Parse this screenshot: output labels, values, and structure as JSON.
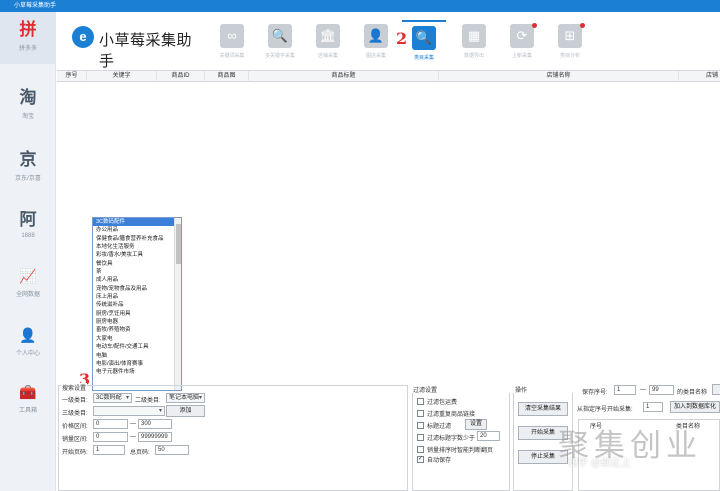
{
  "window": {
    "title": "小草莓采集助手"
  },
  "sidebar": {
    "items": [
      {
        "glyph": "拼",
        "label": "拼多多",
        "active": true
      },
      {
        "glyph": "淘",
        "label": "淘宝"
      },
      {
        "glyph": "京",
        "label": "京东/京喜"
      },
      {
        "glyph": "阿",
        "label": "1688"
      },
      {
        "glyph": "📈",
        "label": "全网数据"
      },
      {
        "glyph": "👤",
        "label": "个人中心"
      },
      {
        "glyph": "🧰",
        "label": "工具箱"
      }
    ]
  },
  "app": {
    "logo_mark": "e",
    "name": "小草莓采集助手"
  },
  "toolbar": {
    "items": [
      {
        "icon": "∞",
        "label": "关键词采集"
      },
      {
        "icon": "🔍",
        "label": "多关键字采集"
      },
      {
        "icon": "🏛",
        "label": "店铺采集"
      },
      {
        "icon": "👤",
        "label": "图店采集"
      },
      {
        "icon": "🔍",
        "label": "类目采集",
        "active": true
      },
      {
        "icon": "▦",
        "label": "数据导出"
      },
      {
        "icon": "⟳",
        "label": "上新采集"
      },
      {
        "icon": "⊞",
        "label": "类目分析"
      }
    ]
  },
  "grid": {
    "columns": [
      "序号",
      "关键字",
      "商品ID",
      "商品图",
      "商品标题",
      "店铺名称",
      "店铺"
    ]
  },
  "category_dropdown": {
    "options": [
      "3C数码配件",
      "办公用品",
      "保健食品/膳食营养补充食品",
      "本地化生活服务",
      "彩妆/香水/美妆工具",
      "餐饮具",
      "茶",
      "成人用品",
      "宠物/宠物食品及用品",
      "床上用品",
      "传统滋补品",
      "厨房/烹饪用具",
      "厨房电器",
      "畜牧/养殖物资",
      "大家电",
      "电动车/配件/交通工具",
      "电脑",
      "电影/演出/体育赛事",
      "电子元器件市场"
    ],
    "selected": "3C数码配件"
  },
  "search_settings": {
    "title": "搜索设置",
    "level1_label": "一级类目:",
    "level1_value": "3C数码配",
    "level2_label": "二级类目:",
    "level2_value": "笔记本电脑",
    "level3_label": "三级类目:",
    "level3_value": "",
    "add_button": "添加",
    "price_label": "价格区间:",
    "price_min": "0",
    "price_max": "300",
    "dash": "—",
    "sales_label": "销量区间:",
    "sales_min": "0",
    "sales_max": "99999999",
    "start_page_label": "开始页码:",
    "start_page": "1",
    "total_pages_label": "总页码:",
    "total_pages": "50"
  },
  "filter_settings": {
    "title": "过滤设置",
    "options": [
      {
        "label": "过滤包运费",
        "checked": false
      },
      {
        "label": "过滤重复商品链接",
        "checked": false
      },
      {
        "label": "标题过滤",
        "checked": false,
        "button": "设置"
      },
      {
        "label": "过滤标题字数少于",
        "checked": false,
        "value": "20"
      },
      {
        "label": "销量排序时智能判断翻页",
        "checked": false
      },
      {
        "label": "自动保存",
        "checked": true
      }
    ]
  },
  "operations": {
    "title": "操作",
    "clear_button": "清空采集结果",
    "start_button": "开始采集",
    "stop_button": "停止采集"
  },
  "right_panel": {
    "save_seq_label": "保存序号:",
    "save_from": "1",
    "dash": "—",
    "save_to": "99",
    "category_name_label": "的类目名称",
    "continue_label": "从指定序号开始采集:",
    "continue_value": "1",
    "add_to_db_button": "加入到数据库化",
    "col_seq": "序号",
    "col_category": "类目名称"
  },
  "annotations": {
    "left_marker": "3",
    "toolbar_marker": "2"
  },
  "watermark": {
    "main": "聚集创业",
    "sub": "知乎 @郭正上"
  }
}
